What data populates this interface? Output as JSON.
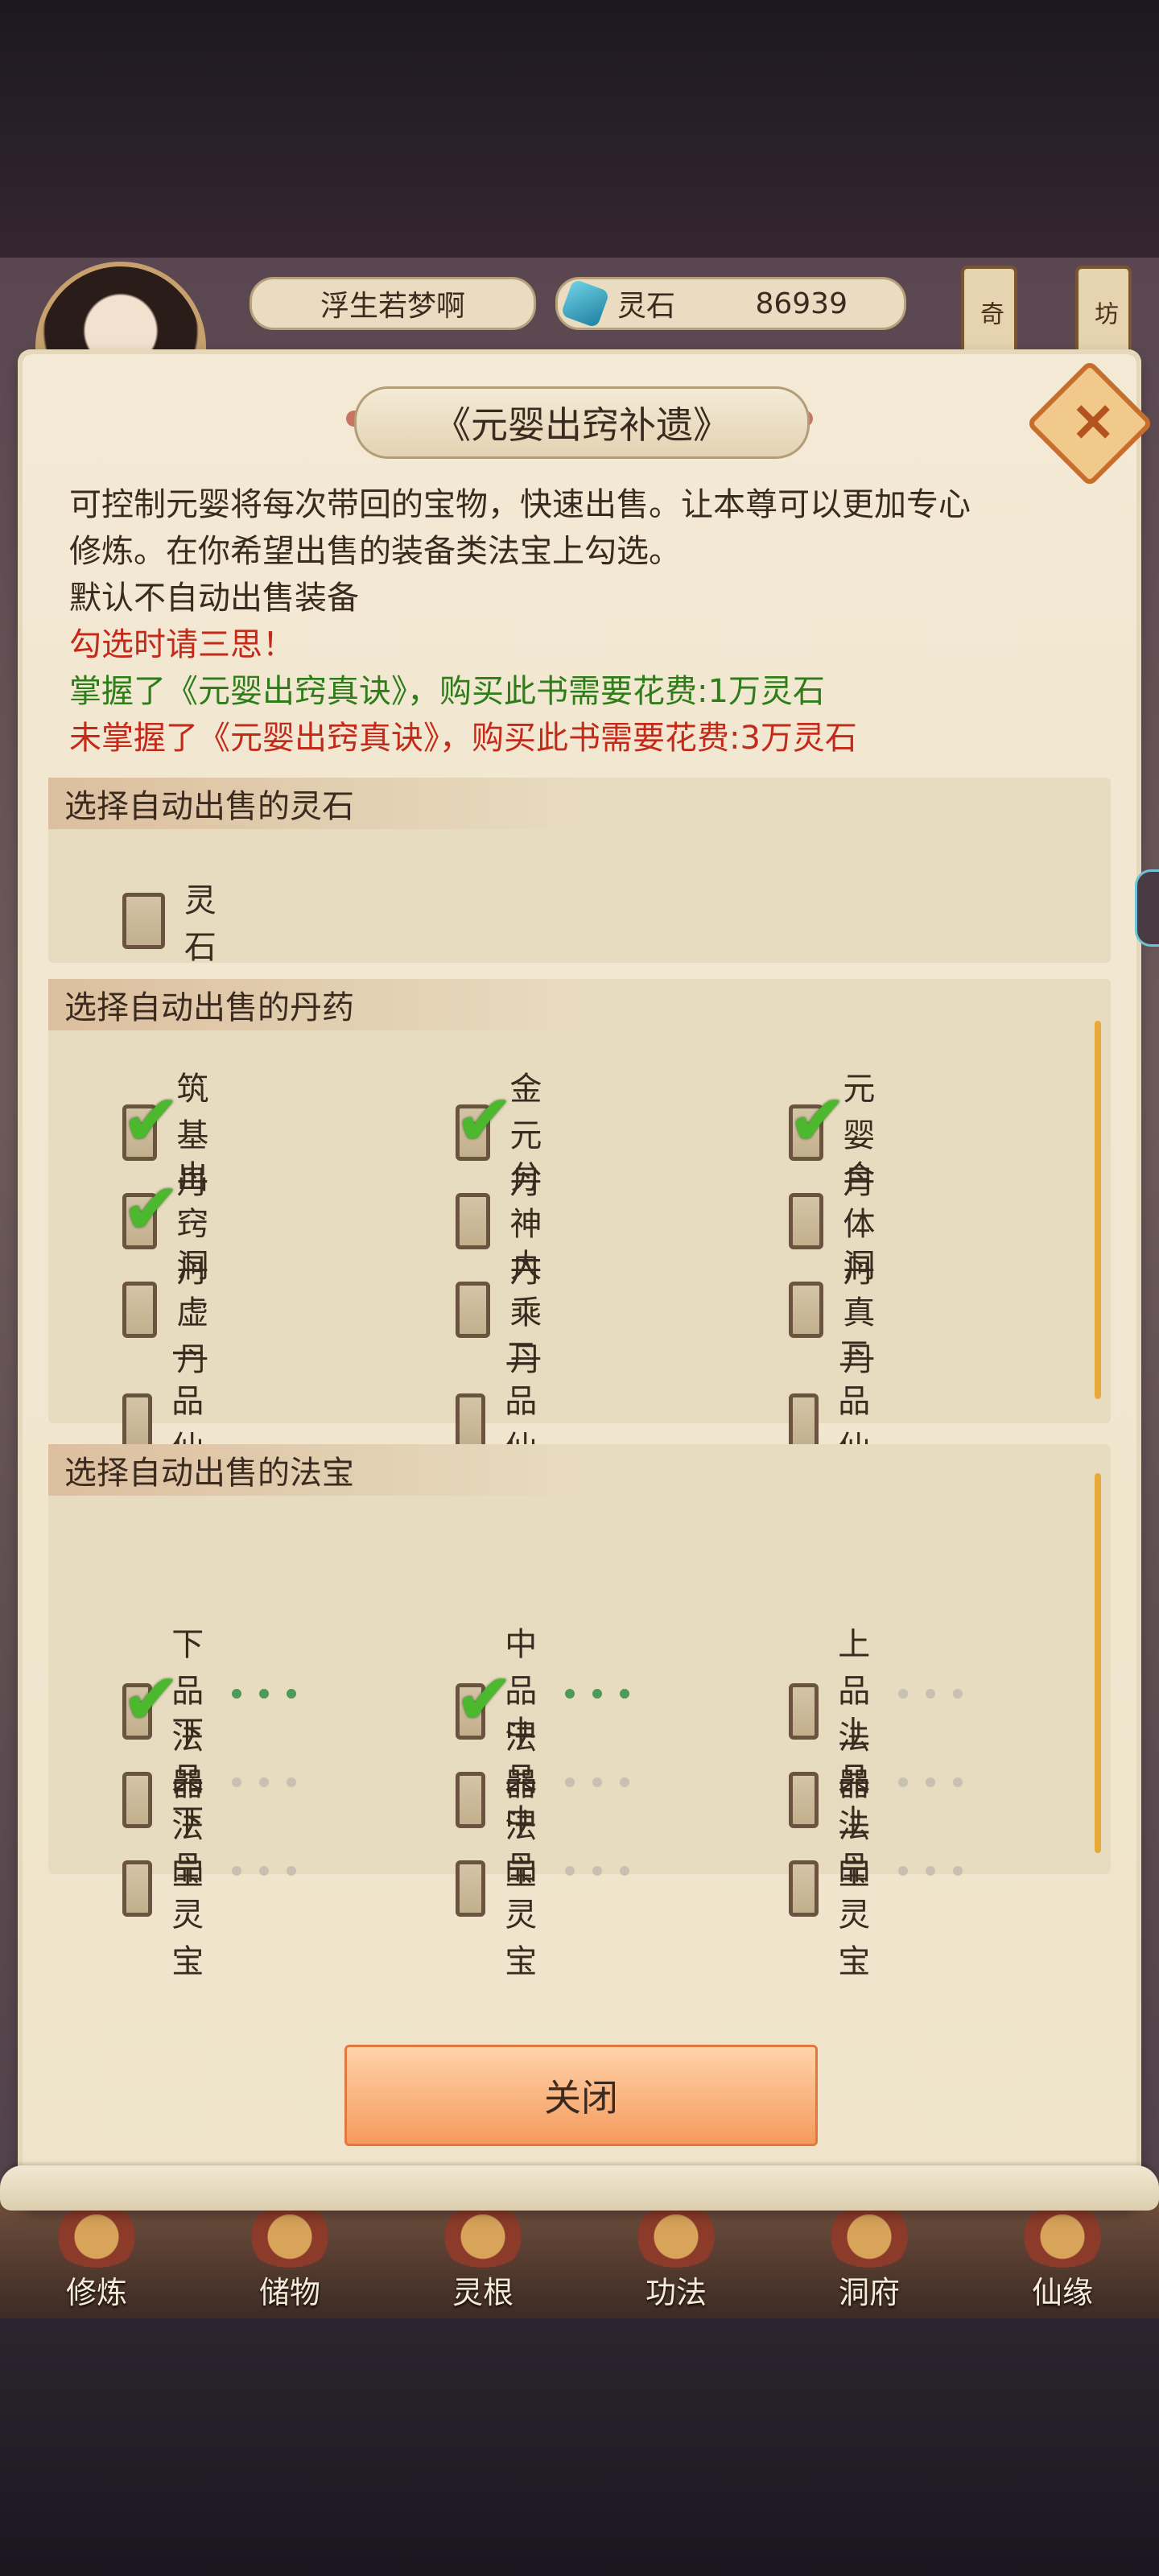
{
  "hud": {
    "player_name": "浮生若梦啊",
    "stone_label": "灵石",
    "stone_value": "86939",
    "side_tabs": [
      "奇",
      "坊"
    ]
  },
  "dialog": {
    "title": "《元婴出窍补遗》",
    "close_icon": "×",
    "desc_line1": "可控制元婴将每次带回的宝物，快速出售。让本尊可以更加专心",
    "desc_line2": "修炼。在你希望出售的装备类法宝上勾选。",
    "desc_line3": "默认不自动出售装备",
    "warn_line": "勾选时请三思！",
    "cost_known": "掌握了《元婴出窍真诀》，购买此书需要花费:1万灵石",
    "cost_unknown": "未掌握了《元婴出窍真诀》，购买此书需要花费:3万灵石",
    "close_button": "关闭"
  },
  "sections": {
    "stone": {
      "header": "选择自动出售的灵石",
      "items": [
        {
          "label": "灵石",
          "checked": false
        }
      ]
    },
    "pill": {
      "header": "选择自动出售的丹药",
      "items": [
        {
          "label": "筑基丹",
          "checked": true
        },
        {
          "label": "金元丹",
          "checked": true
        },
        {
          "label": "元婴丹",
          "checked": true
        },
        {
          "label": "出窍丹",
          "checked": true
        },
        {
          "label": "分神丹",
          "checked": false
        },
        {
          "label": "合体丹",
          "checked": false
        },
        {
          "label": "洞虚丹",
          "checked": false
        },
        {
          "label": "大乘丹",
          "checked": false
        },
        {
          "label": "洞真丹",
          "checked": false
        },
        {
          "label": "一品仙丹",
          "checked": false
        },
        {
          "label": "二品仙丹",
          "checked": false
        },
        {
          "label": "三品仙丹",
          "checked": false
        }
      ]
    },
    "treasure": {
      "header": "选择自动出售的法宝",
      "items": [
        {
          "label": "下品法器",
          "checked": true,
          "dots_active": true
        },
        {
          "label": "中品法器",
          "checked": true,
          "dots_active": true
        },
        {
          "label": "上品法器",
          "checked": false,
          "dots_active": false
        },
        {
          "label": "下品法宝",
          "checked": false,
          "dots_active": false
        },
        {
          "label": "中品法宝",
          "checked": false,
          "dots_active": false
        },
        {
          "label": "上品法宝",
          "checked": false,
          "dots_active": false
        },
        {
          "label": "下品灵宝",
          "checked": false,
          "dots_active": false
        },
        {
          "label": "中品灵宝",
          "checked": false,
          "dots_active": false
        },
        {
          "label": "上品灵宝",
          "checked": false,
          "dots_active": false
        }
      ]
    }
  },
  "bottom_nav": [
    "修炼",
    "储物",
    "灵根",
    "功法",
    "洞府",
    "仙缘"
  ],
  "colors": {
    "check": "#4bb82d",
    "dot_active": "#4f9a5a",
    "dot_inactive": "#c8c0b0",
    "warn": "#c42a1a",
    "green_text": "#2e7d19"
  }
}
